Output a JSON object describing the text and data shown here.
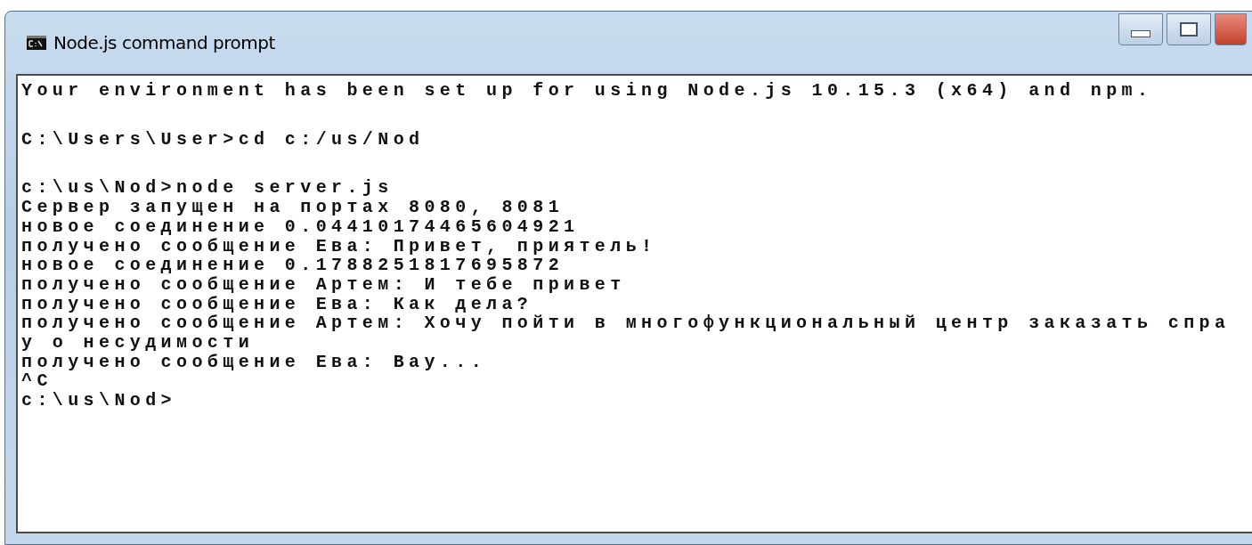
{
  "window": {
    "title": "Node.js command prompt"
  },
  "console": {
    "groups": [
      [
        "Your environment has been set up for using Node.js 10.15.3 (x64) and npm."
      ],
      [
        "C:\\Users\\User>cd c:/us/Nod"
      ],
      [
        "c:\\us\\Nod>node server.js",
        "Сервер запущен на портах 8080, 8081",
        "новое соединение 0.04410174465604921",
        "получено сообщение Ева: Привет, приятель!",
        "новое соединение 0.1788251817695872",
        "получено сообщение Артем: И тебе привет",
        "получено сообщение Ева: Как дела?",
        "получено сообщение Артем: Хочу пойти в многофункциональный центр заказать спра",
        "у о несудимости",
        "получено сообщение Ева: Вау...",
        "^C",
        "c:\\us\\Nod>"
      ]
    ]
  }
}
